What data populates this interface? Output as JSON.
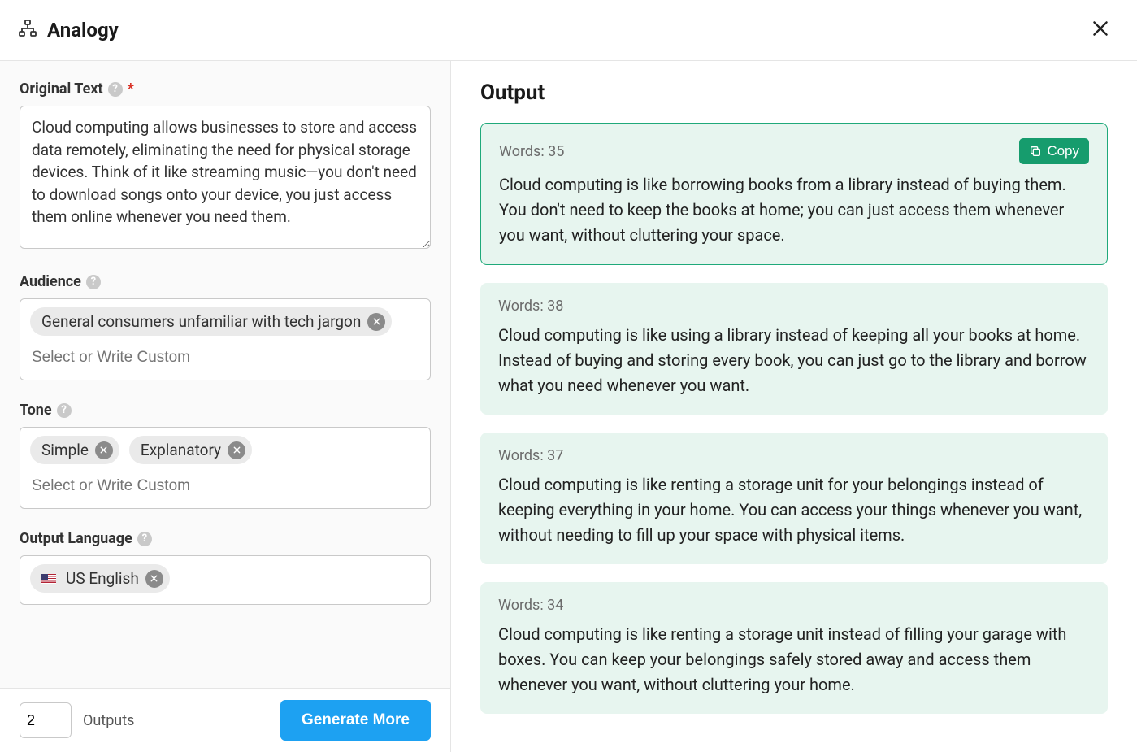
{
  "header": {
    "title": "Analogy"
  },
  "form": {
    "original_text": {
      "label": "Original Text",
      "value": "Cloud computing allows businesses to store and access data remotely, eliminating the need for physical storage devices. Think of it like streaming music—you don't need to download songs onto your device, you just access them online whenever you need them."
    },
    "audience": {
      "label": "Audience",
      "tags": [
        "General consumers unfamiliar with tech jargon"
      ],
      "placeholder": "Select or Write Custom"
    },
    "tone": {
      "label": "Tone",
      "tags": [
        "Simple",
        "Explanatory"
      ],
      "placeholder": "Select or Write Custom"
    },
    "output_language": {
      "label": "Output Language",
      "tags": [
        "US English"
      ]
    }
  },
  "footer": {
    "outputs_count": "2",
    "outputs_label": "Outputs",
    "generate_label": "Generate More"
  },
  "output": {
    "title": "Output",
    "copy_label": "Copy",
    "cards": [
      {
        "words": "Words: 35",
        "selected": true,
        "text": "Cloud computing is like borrowing books from a library instead of buying them. You don't need to keep the books at home; you can just access them whenever you want, without cluttering your space."
      },
      {
        "words": "Words: 38",
        "selected": false,
        "text": "Cloud computing is like using a library instead of keeping all your books at home. Instead of buying and storing every book, you can just go to the library and borrow what you need whenever you want."
      },
      {
        "words": "Words: 37",
        "selected": false,
        "text": "Cloud computing is like renting a storage unit for your belongings instead of keeping everything in your home. You can access your things whenever you want, without needing to fill up your space with physical items."
      },
      {
        "words": "Words: 34",
        "selected": false,
        "text": "Cloud computing is like renting a storage unit instead of filling your garage with boxes. You can keep your belongings safely stored away and access them whenever you want, without cluttering your home."
      }
    ]
  }
}
